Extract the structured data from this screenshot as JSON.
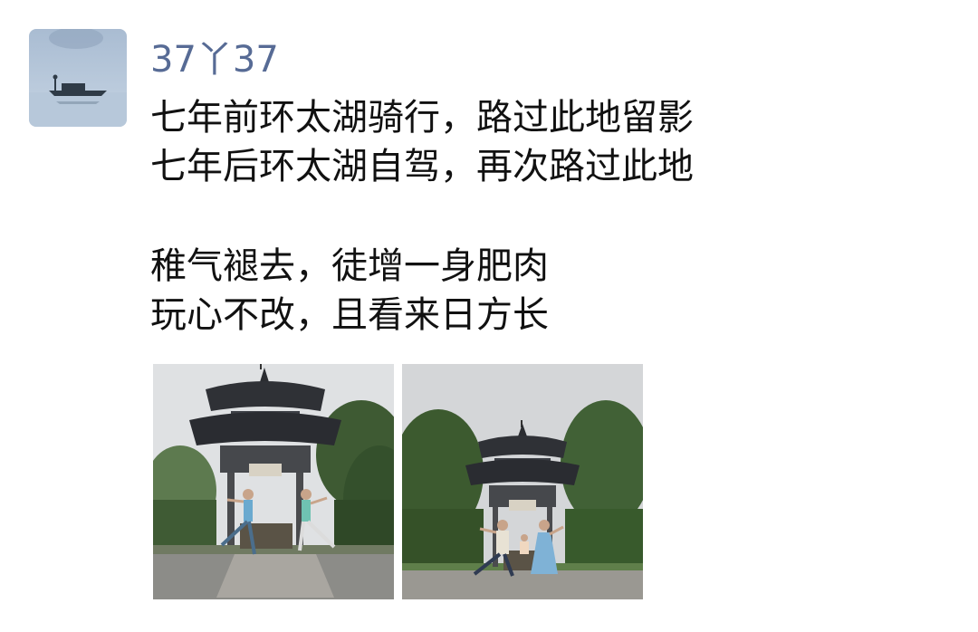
{
  "post": {
    "author": {
      "name": "37丫37",
      "avatar_icon": "lake-boat-avatar"
    },
    "text_lines": [
      "七年前环太湖骑行，路过此地留影",
      "七年后环太湖自驾，再次路过此地",
      "",
      "稚气褪去，徒增一身肥肉",
      "玩心不改，且看来日方长"
    ],
    "photos": [
      {
        "icon": "pavilion-photo-icon"
      },
      {
        "icon": "pavilion-photo-icon"
      }
    ],
    "colors": {
      "username": "#576b95",
      "text": "#111111",
      "background": "#ffffff"
    }
  }
}
